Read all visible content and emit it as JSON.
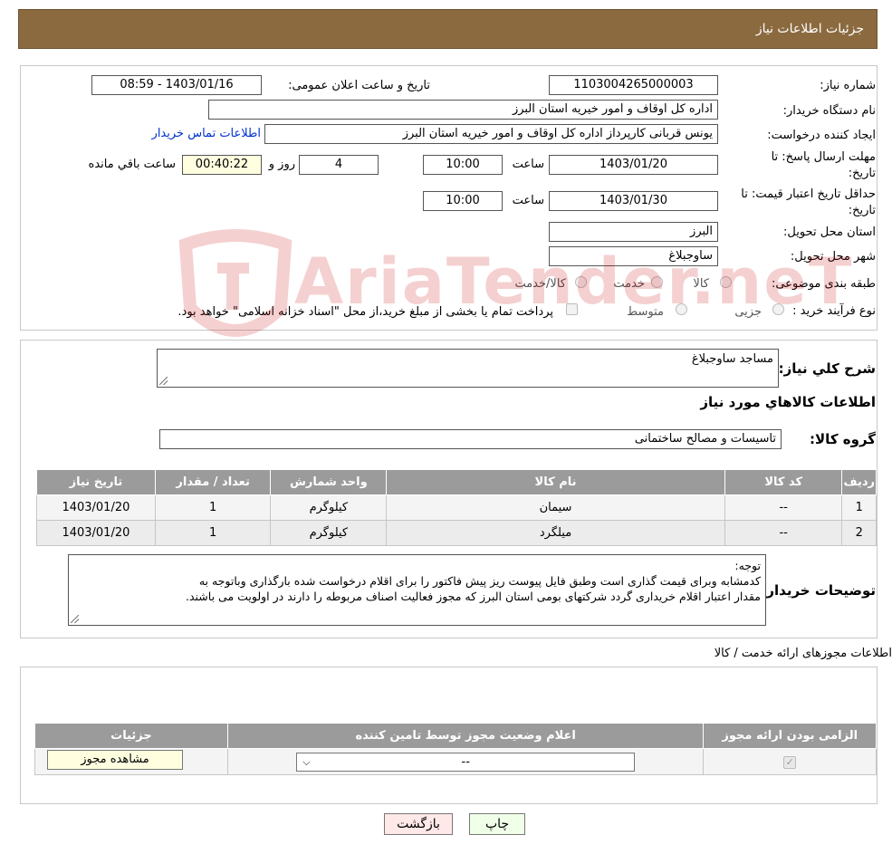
{
  "header": {
    "title": "جزئیات اطلاعات نیاز"
  },
  "form": {
    "need_number_label": "شماره نیاز:",
    "need_number": "1103004265000003",
    "announce_label": "تاریخ و ساعت اعلان عمومی:",
    "announce_value": "1403/01/16 - 08:59",
    "buyer_org_label": "نام دستگاه خریدار:",
    "buyer_org": "اداره کل اوقاف و امور خیریه استان البرز",
    "creator_label": "ایجاد کننده درخواست:",
    "creator": "یونس قربانی کارپرداز اداره کل اوقاف و امور خیریه استان البرز",
    "contact_link": "اطلاعات تماس خریدار",
    "deadline_label_1": "مهلت ارسال پاسخ: تا",
    "deadline_label_2": "تاریخ:",
    "deadline_date": "1403/01/20",
    "time_label": "ساعت",
    "deadline_time": "10:00",
    "days_value": "4",
    "days_label": "روز و",
    "remaining_value": "00:40:22",
    "remaining_label": "ساعت باقي مانده",
    "validity_label_1": "حداقل تاریخ اعتبار قیمت: تا",
    "validity_label_2": "تاریخ:",
    "validity_date": "1403/01/30",
    "validity_time": "10:00",
    "province_label": "استان محل تحویل:",
    "province": "البرز",
    "city_label": "شهر محل تحویل:",
    "city": "ساوجبلاغ",
    "category_label": "طبقه بندی موضوعی:",
    "category_options": [
      "کالا",
      "خدمت",
      "کالا/خدمت"
    ],
    "process_label": "نوع فرآیند خرید :",
    "process_options": [
      "جزیی",
      "متوسط"
    ],
    "process_note": "پرداخت تمام یا بخشی از مبلغ خرید،از محل \"اسناد خزانه اسلامی\" خواهد بود."
  },
  "details": {
    "summary_label": "شرح کلي نياز:",
    "summary": "مساجد ساوجبلاغ",
    "goods_info_title": "اطلاعات کالاهاي مورد نياز",
    "goods_group_label": "گروه کالا:",
    "goods_group": "تاسیسات و مصالح ساختمانی",
    "table_headers": [
      "ردیف",
      "کد کالا",
      "نام کالا",
      "واحد شمارش",
      "تعداد / مقدار",
      "تاریخ نیاز"
    ],
    "rows": [
      [
        "1",
        "--",
        "سیمان",
        "کیلوگرم",
        "1",
        "1403/01/20"
      ],
      [
        "2",
        "--",
        "میلگرد",
        "کیلوگرم",
        "1",
        "1403/01/20"
      ]
    ],
    "buyer_notes_label": "توضیحات خریدار:",
    "buyer_notes_line1": "توجه:",
    "buyer_notes_line2": "کدمشابه وبرای قیمت گذاری است وطبق فایل پیوست ریز پیش فاکتور را برای اقلام درخواست شده بارگذاری وباتوجه به",
    "buyer_notes_line3": "مقدار اعتبار اقلام خریداری گردد شرکتهای بومی استان البرز که مجوز فعالیت اصناف مربوطه را دارند در اولویت می باشند."
  },
  "permits": {
    "title": "اطلاعات مجوزهای ارائه خدمت / کالا",
    "headers": [
      "الزامی بودن ارائه مجوز",
      "اعلام وضعیت مجوز توسط تامین کننده",
      "جزئیات"
    ],
    "select_value": "--",
    "view_button": "مشاهده مجوز"
  },
  "footer": {
    "print_button": "چاپ",
    "back_button": "بازگشت"
  },
  "watermark": {
    "text": "AriaTender.neT"
  }
}
